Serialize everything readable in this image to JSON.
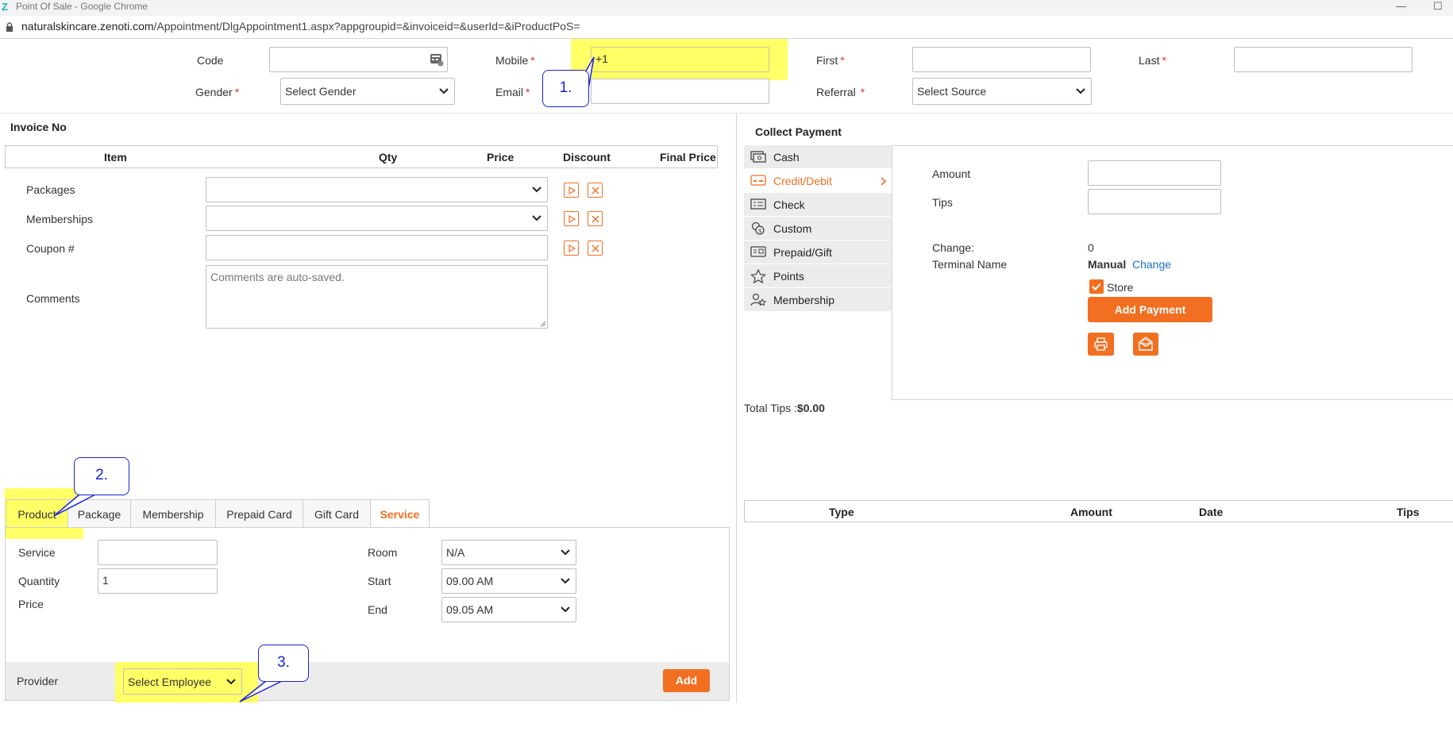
{
  "browser": {
    "title": "Point Of Sale - Google Chrome",
    "url_host": "naturalskincare.zenoti.com",
    "url_path": "/Appointment/DlgAppointment1.aspx?appgroupid=&invoiceid=&userId=&iProductPoS="
  },
  "guest": {
    "code_label": "Code",
    "code_value": "",
    "mobile_label": "Mobile",
    "mobile_value": "+1",
    "first_label": "First",
    "first_value": "",
    "last_label": "Last",
    "last_value": "",
    "gender_label": "Gender",
    "gender_value": "Select Gender",
    "email_label": "Email",
    "email_value": "",
    "referral_label": "Referral",
    "referral_value": "Select Source",
    "required_mark": "*"
  },
  "invoice": {
    "title": "Invoice No",
    "columns": [
      "Item",
      "Qty",
      "Price",
      "Discount",
      "Final Price"
    ],
    "packages_label": "Packages",
    "memberships_label": "Memberships",
    "coupon_label": "Coupon #",
    "comments_label": "Comments",
    "comments_placeholder": "Comments are auto-saved."
  },
  "payment": {
    "title": "Collect Payment",
    "methods": [
      "Cash",
      "Credit/Debit",
      "Check",
      "Custom",
      "Prepaid/Gift",
      "Points",
      "Membership"
    ],
    "active_method": "Credit/Debit",
    "amount_label": "Amount",
    "tips_label": "Tips",
    "change_label": "Change:",
    "change_value": "0",
    "terminal_label": "Terminal Name",
    "terminal_value": "Manual",
    "terminal_change_link": "Change",
    "store_label": "Store",
    "store_checked": true,
    "add_payment_label": "Add Payment",
    "total_tips_label": "Total Tips :",
    "total_tips_value": "$0.00",
    "table_columns": [
      "Type",
      "Amount",
      "Date",
      "Tips"
    ]
  },
  "item_tabs": {
    "tabs": [
      "Product",
      "Package",
      "Membership",
      "Prepaid Card",
      "Gift Card",
      "Service"
    ],
    "active_tab": "Service",
    "service_label": "Service",
    "service_value": "",
    "quantity_label": "Quantity",
    "quantity_value": "1",
    "price_label": "Price",
    "room_label": "Room",
    "room_value": "N/A",
    "start_label": "Start",
    "start_value": "09.00 AM",
    "end_label": "End",
    "end_value": "09.05 AM",
    "provider_label": "Provider",
    "provider_value": "Select Employee",
    "add_label": "Add"
  },
  "annotations": {
    "callout_1": "1.",
    "callout_2": "2.",
    "callout_3": "3."
  },
  "colors": {
    "accent": "#f26f21",
    "highlight": "#ffff66",
    "link": "#1a73c8",
    "callout": "#1a23d8",
    "required": "#e0321c"
  }
}
